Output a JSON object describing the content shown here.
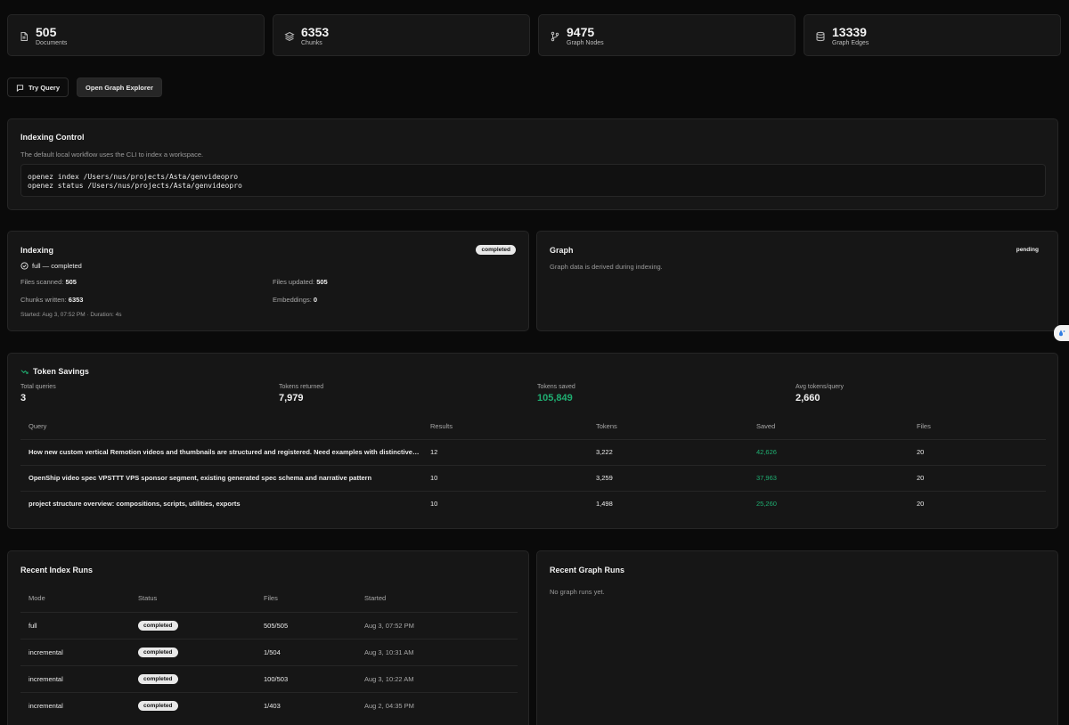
{
  "stats": [
    {
      "value": "505",
      "label": "Documents",
      "icon": "document-icon"
    },
    {
      "value": "6353",
      "label": "Chunks",
      "icon": "layers-icon"
    },
    {
      "value": "9475",
      "label": "Graph Nodes",
      "icon": "git-branch-icon"
    },
    {
      "value": "13339",
      "label": "Graph Edges",
      "icon": "database-icon"
    }
  ],
  "actions": {
    "try_query": "Try Query",
    "open_graph_explorer": "Open Graph Explorer"
  },
  "indexing_control": {
    "title": "Indexing Control",
    "description": "The default local workflow uses the CLI to index a workspace.",
    "commands": [
      "openez index /Users/nus/projects/Asta/genvideopro",
      "openez status /Users/nus/projects/Asta/genvideopro"
    ]
  },
  "indexing": {
    "title": "Indexing",
    "badge": "completed",
    "mode_status": "full — completed",
    "files_scanned_label": "Files scanned:",
    "files_scanned": "505",
    "files_updated_label": "Files updated:",
    "files_updated": "505",
    "chunks_written_label": "Chunks written:",
    "chunks_written": "6353",
    "embeddings_label": "Embeddings:",
    "embeddings": "0",
    "footer": "Started: Aug 3, 07:52 PM · Duration: 4s"
  },
  "graph": {
    "title": "Graph",
    "badge": "pending",
    "description": "Graph data is derived during indexing."
  },
  "token_savings": {
    "title": "Token Savings",
    "metrics": [
      {
        "label": "Total queries",
        "value": "3",
        "accent": false
      },
      {
        "label": "Tokens returned",
        "value": "7,979",
        "accent": false
      },
      {
        "label": "Tokens saved",
        "value": "105,849",
        "accent": true
      },
      {
        "label": "Avg tokens/query",
        "value": "2,660",
        "accent": false
      }
    ],
    "columns": [
      "Query",
      "Results",
      "Tokens",
      "Saved",
      "Files"
    ],
    "rows": [
      {
        "query": "How new custom vertical Remotion videos and thumbnails are structured and registered. Need examples with distinctive…",
        "results": "12",
        "tokens": "3,222",
        "saved": "42,626",
        "files": "20"
      },
      {
        "query": "OpenShip video spec VPSTTT VPS sponsor segment, existing generated spec schema and narrative pattern",
        "results": "10",
        "tokens": "3,259",
        "saved": "37,963",
        "files": "20"
      },
      {
        "query": "project structure overview: compositions, scripts, utilities, exports",
        "results": "10",
        "tokens": "1,498",
        "saved": "25,260",
        "files": "20"
      }
    ],
    "accent_color": "#1fae71"
  },
  "recent_index_runs": {
    "title": "Recent Index Runs",
    "columns": [
      "Mode",
      "Status",
      "Files",
      "Started"
    ],
    "rows": [
      {
        "mode": "full",
        "status": "completed",
        "files": "505/505",
        "started": "Aug 3, 07:52 PM"
      },
      {
        "mode": "incremental",
        "status": "completed",
        "files": "1/504",
        "started": "Aug 3, 10:31 AM"
      },
      {
        "mode": "incremental",
        "status": "completed",
        "files": "100/503",
        "started": "Aug 3, 10:22 AM"
      },
      {
        "mode": "incremental",
        "status": "completed",
        "files": "1/403",
        "started": "Aug 2, 04:35 PM"
      }
    ]
  },
  "recent_graph_runs": {
    "title": "Recent Graph Runs",
    "empty_text": "No graph runs yet."
  }
}
